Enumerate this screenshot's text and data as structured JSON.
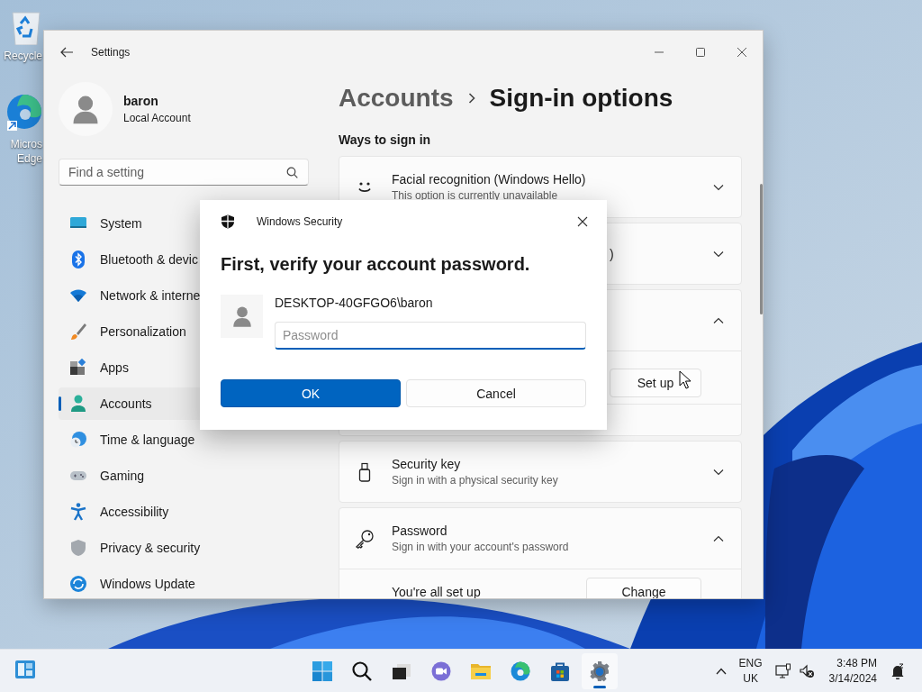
{
  "desktop": {
    "icons": [
      {
        "lines": [
          "Recycle"
        ]
      },
      {
        "lines": [
          "Micros",
          "Edge"
        ]
      }
    ]
  },
  "settings": {
    "title": "Settings",
    "profile": {
      "name": "baron",
      "account_type": "Local Account"
    },
    "search": {
      "placeholder": "Find a setting"
    },
    "nav": [
      {
        "label": "System",
        "selected": false
      },
      {
        "label": "Bluetooth & devic",
        "selected": false
      },
      {
        "label": "Network & interne",
        "selected": false
      },
      {
        "label": "Personalization",
        "selected": false
      },
      {
        "label": "Apps",
        "selected": false
      },
      {
        "label": "Accounts",
        "selected": true
      },
      {
        "label": "Time & language",
        "selected": false
      },
      {
        "label": "Gaming",
        "selected": false
      },
      {
        "label": "Accessibility",
        "selected": false
      },
      {
        "label": "Privacy & security",
        "selected": false
      },
      {
        "label": "Windows Update",
        "selected": false
      }
    ],
    "breadcrumb": {
      "parent": "Accounts",
      "current": "Sign-in options"
    },
    "section_title": "Ways to sign in",
    "options": [
      {
        "kind": "face",
        "title": "Facial recognition (Windows Hello)",
        "subtitle": "This option is currently unavailable",
        "expanded": false
      },
      {
        "kind": "covered",
        "title": ")",
        "expanded": false
      },
      {
        "kind": "covered",
        "expanded": true,
        "action": "Set up"
      },
      {
        "kind": "usb",
        "title": "Security key",
        "subtitle": "Sign in with a physical security key",
        "expanded": false
      },
      {
        "kind": "password",
        "title": "Password",
        "subtitle": "Sign in with your account's password",
        "expanded": true,
        "detail": "You're all set up",
        "action": "Change"
      }
    ]
  },
  "dialog": {
    "title": "Windows Security",
    "heading": "First, verify your account password.",
    "user": "DESKTOP-40GFGO6\\baron",
    "password": {
      "placeholder": "Password",
      "focused": true
    },
    "buttons": [
      {
        "label": "OK",
        "primary": true
      },
      {
        "label": "Cancel",
        "primary": false
      }
    ]
  },
  "taskbar": {
    "apps": [
      {
        "selected": false
      },
      {
        "selected": false
      },
      {
        "selected": false
      },
      {
        "selected": false
      },
      {
        "selected": false
      },
      {
        "selected": false
      },
      {
        "selected": false
      },
      {
        "selected": true
      }
    ],
    "language": [
      "ENG",
      "UK"
    ],
    "clock": {
      "time": "3:48 PM",
      "date": "3/14/2024"
    }
  }
}
